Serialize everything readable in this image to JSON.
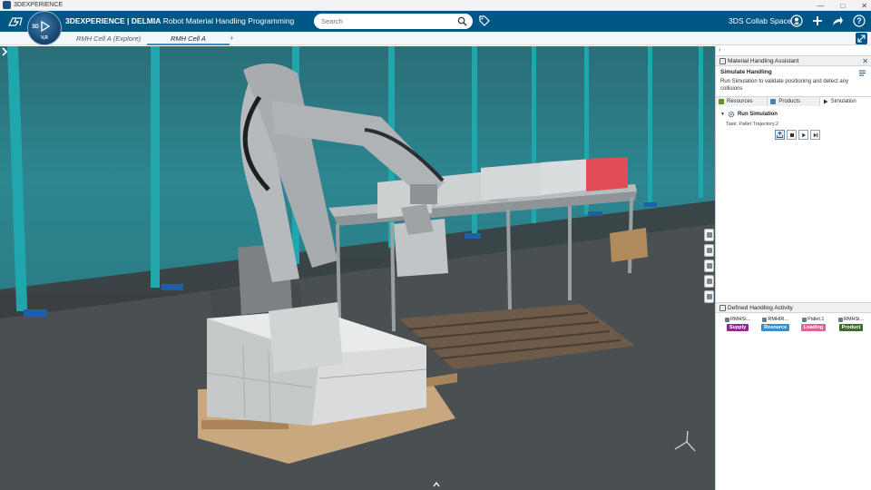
{
  "os": {
    "title": "3DEXPERIENCE",
    "min": "—",
    "max": "□",
    "close": "✕"
  },
  "topbar": {
    "brand_prefix": "3DEXPERIENCE | DELMIA",
    "app_name": "Robot Material Handling Programming",
    "search_placeholder": "Search",
    "collab_space": "3DS Collab Space",
    "compass_3d": "3D",
    "compass_v": "V,R"
  },
  "tabs": [
    {
      "label": "RMH Cell A (Explore)"
    },
    {
      "label": "RMH Cell A"
    }
  ],
  "tab_plus": "+",
  "panel": {
    "collapse": "›",
    "header": "Material Handling Assistant",
    "close": "✕",
    "sim_title": "Simulate Handling",
    "sim_desc": "Run Simulation to validate positioning and detect any collisions",
    "tabs": [
      {
        "label": "Resources",
        "color": "#6b8e23"
      },
      {
        "label": "Products",
        "color": "#4a7fb5"
      },
      {
        "label": "Simulation",
        "color": "#333333"
      }
    ],
    "run_caret": "▼",
    "run_label": "Run Simulation",
    "task": "Task:  Pallet Trajectory.2",
    "activity_header": "Defined Handling Activity",
    "activities": [
      {
        "name": "RMHSi...",
        "badge": "Supply",
        "color": "#8e2a8f"
      },
      {
        "name": "RMHIR...",
        "badge": "Resource",
        "color": "#3d8cc9"
      },
      {
        "name": "Pallet.1",
        "badge": "Loading",
        "color": "#e85d96"
      },
      {
        "name": "RMHSi...",
        "badge": "Product",
        "color": "#3e6d2a"
      }
    ]
  },
  "colors": {
    "topbar": "#005685",
    "accent": "#3d8cc9"
  }
}
